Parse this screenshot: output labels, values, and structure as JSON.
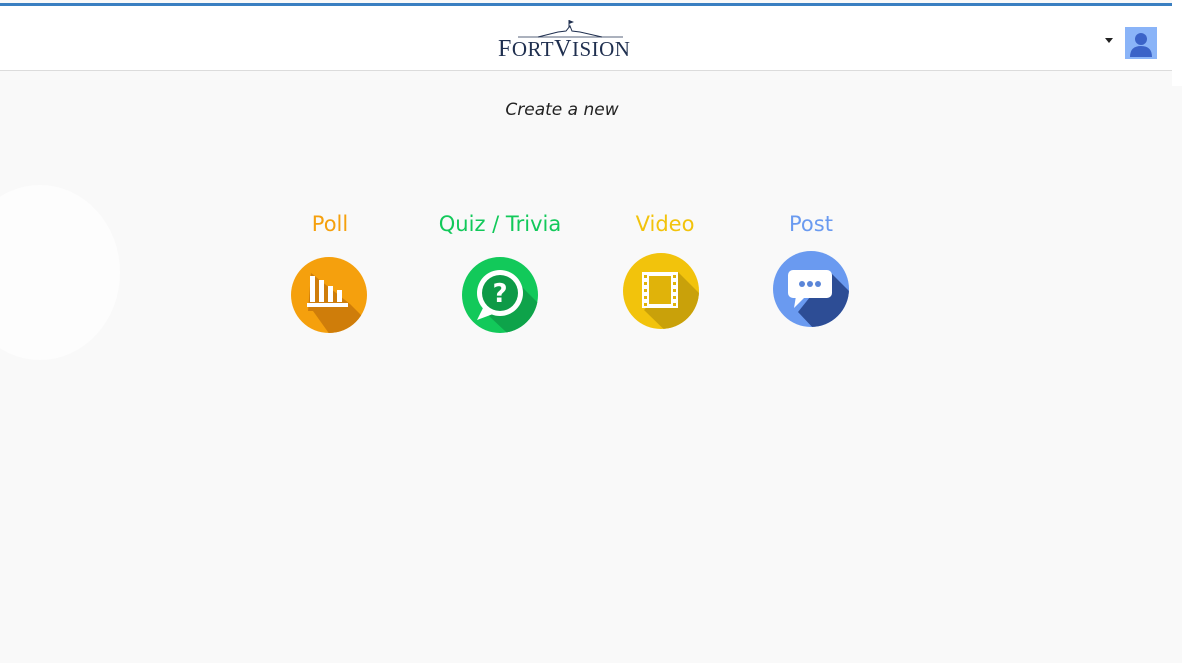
{
  "header": {
    "logo_text": "FortVision",
    "logo_f": "F",
    "logo_ort": "ORT",
    "logo_v": "V",
    "logo_ision": "ISION"
  },
  "main": {
    "subtitle": "Create a new",
    "options": [
      {
        "label": "Poll",
        "color": "#f5a00d",
        "icon": "bar-chart-icon"
      },
      {
        "label": "Quiz / Trivia",
        "color": "#12c95a",
        "icon": "question-bubble-icon"
      },
      {
        "label": "Video",
        "color": "#f2c30c",
        "icon": "film-icon"
      },
      {
        "label": "Post",
        "color": "#6a9af0",
        "icon": "chat-bubble-icon"
      }
    ]
  },
  "colors": {
    "accent": "#3a7fc1",
    "poll": "#f5a00d",
    "quiz": "#12c95a",
    "video": "#f2c30c",
    "post": "#6a9af0"
  }
}
